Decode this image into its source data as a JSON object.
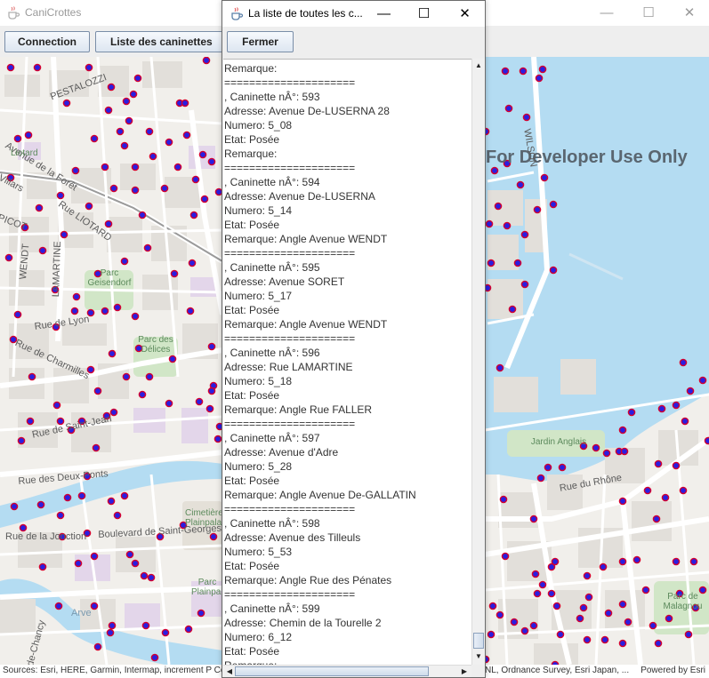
{
  "main_window": {
    "title": "CaniCrottes",
    "buttons": {
      "connection": "Connection",
      "list": "Liste des caninettes"
    },
    "controls": {
      "minimize": "—",
      "maximize": "☐",
      "close": "✕"
    }
  },
  "map": {
    "watermark": "For Developer Use Only",
    "labels": {
      "pestalozzi": "PESTALOZZI",
      "ave_forets": "Avenue de la Forêt",
      "liotard": "Liotard",
      "villars": "Villars",
      "lamartine": "LAMARTINE",
      "wendt": "WENDT",
      "picot": "PICOT",
      "rue_liotard": "Rue LIOTARD",
      "rue_lyon": "Rue de Lyon",
      "charmilles": "Rue de Charmilles",
      "parc_geisendorf": "Parc Geisendorf",
      "parc_delices": "Parc des Délices",
      "rue_saint_jean": "Rue de Saint-Jean",
      "rue_des_deux_ponts": "Rue des Deux-Ponts",
      "jonction": "Rue de la Jonction",
      "bd_saint_georges": "Boulevard de Saint-Georges",
      "cimetiere": "Cimetière Plainpalais",
      "arve": "Arve",
      "plainpalais": "Parc Plainpalais",
      "jardin_anglais": "Jardin Anglais",
      "rue_du_rhone": "Rue du Rhône",
      "parc_malagnou": "Parc de Malagnou",
      "wilson": "WILSON",
      "chancy": "de-Chancy"
    },
    "attribution": {
      "left": "Sources: Esri, HERE, Garmin, Intermap, increment P Corp., ...",
      "middle": "NL, Ordnance Survey, Esri Japan, ...",
      "right": "Powered by Esri"
    },
    "colors": {
      "marker_fill": "#2a1ee0",
      "marker_stroke": "#d4002f",
      "water": "#b4dcf2"
    }
  },
  "dialog": {
    "title": "La liste de toutes les c...",
    "controls": {
      "minimize": "—",
      "maximize": "☐",
      "close": "✕"
    },
    "close_button": "Fermer",
    "lines": [
      "Remarque:",
      "=====================",
      ", Caninette nÂ°: 593",
      "Adresse: Avenue De-LUSERNA 28",
      "Numero: 5_08",
      "Etat: Posée",
      "Remarque:",
      "=====================",
      ", Caninette nÂ°: 594",
      "Adresse: Avenue De-LUSERNA",
      "Numero: 5_14",
      "Etat: Posée",
      "Remarque: Angle Avenue WENDT",
      "=====================",
      ", Caninette nÂ°: 595",
      "Adresse: Avenue SORET",
      "Numero: 5_17",
      "Etat: Posée",
      "Remarque: Angle Avenue WENDT",
      "=====================",
      ", Caninette nÂ°: 596",
      "Adresse: Rue LAMARTINE",
      "Numero: 5_18",
      "Etat: Posée",
      "Remarque: Angle Rue FALLER",
      "=====================",
      ", Caninette nÂ°: 597",
      "Adresse: Avenue d'Adre",
      "Numero: 5_28",
      "Etat: Posée",
      "Remarque: Angle Avenue De-GALLATIN",
      "=====================",
      ", Caninette nÂ°: 598",
      "Adresse: Avenue des Tilleuls",
      "Numero: 5_53",
      "Etat: Posée",
      "Remarque: Angle Rue des Pénates",
      "=====================",
      ", Caninette nÂ°: 599",
      "Adresse: Chemin de la Tourelle 2",
      "Numero: 6_12",
      "Etat: Posée",
      "Remarque:"
    ]
  }
}
